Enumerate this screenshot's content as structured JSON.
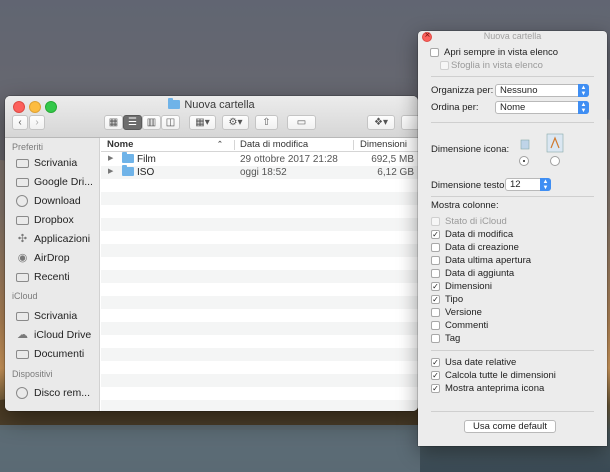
{
  "finder": {
    "title": "Nuova cartella",
    "sidebar": {
      "sections": [
        {
          "heading": "Preferiti",
          "items": [
            {
              "label": "Scrivania",
              "icon": "desktop-icon"
            },
            {
              "label": "Google Dri...",
              "icon": "folder-icon"
            },
            {
              "label": "Download",
              "icon": "download-icon"
            },
            {
              "label": "Dropbox",
              "icon": "folder-icon"
            },
            {
              "label": "Applicazioni",
              "icon": "applications-icon"
            },
            {
              "label": "AirDrop",
              "icon": "airdrop-icon"
            },
            {
              "label": "Recenti",
              "icon": "recents-icon"
            }
          ]
        },
        {
          "heading": "iCloud",
          "items": [
            {
              "label": "Scrivania",
              "icon": "desktop-icon"
            },
            {
              "label": "iCloud Drive",
              "icon": "cloud-icon"
            },
            {
              "label": "Documenti",
              "icon": "documents-icon"
            }
          ]
        },
        {
          "heading": "Dispositivi",
          "items": [
            {
              "label": "Disco rem...",
              "icon": "disk-icon"
            }
          ]
        }
      ]
    },
    "columns": {
      "name": "Nome",
      "date": "Data di modifica",
      "size": "Dimensioni"
    },
    "files": [
      {
        "name": "Film",
        "date": "29 ottobre 2017 21:28",
        "size": "692,5 MB"
      },
      {
        "name": "ISO",
        "date": "oggi 18:52",
        "size": "6,12 GB"
      }
    ]
  },
  "panel": {
    "title": "Nuova cartella",
    "open_list_view": "Apri sempre in vista elenco",
    "browse_list_view": "Sfoglia in vista elenco",
    "group_by_label": "Organizza per:",
    "group_by_value": "Nessuno",
    "sort_by_label": "Ordina per:",
    "sort_by_value": "Nome",
    "icon_size_label": "Dimensione icona:",
    "text_size_label": "Dimensione testo:",
    "text_size_value": "12",
    "show_columns_label": "Mostra colonne:",
    "columns": [
      {
        "label": "Stato di iCloud",
        "checked": false,
        "disabled": true
      },
      {
        "label": "Data di modifica",
        "checked": true,
        "disabled": false
      },
      {
        "label": "Data di creazione",
        "checked": false,
        "disabled": false
      },
      {
        "label": "Data ultima apertura",
        "checked": false,
        "disabled": false
      },
      {
        "label": "Data di aggiunta",
        "checked": false,
        "disabled": false
      },
      {
        "label": "Dimensioni",
        "checked": true,
        "disabled": false
      },
      {
        "label": "Tipo",
        "checked": true,
        "disabled": false
      },
      {
        "label": "Versione",
        "checked": false,
        "disabled": false
      },
      {
        "label": "Commenti",
        "checked": false,
        "disabled": false
      },
      {
        "label": "Tag",
        "checked": false,
        "disabled": false
      }
    ],
    "options": [
      {
        "label": "Usa date relative",
        "checked": true
      },
      {
        "label": "Calcola tutte le dimensioni",
        "checked": true
      },
      {
        "label": "Mostra anteprima icona",
        "checked": true
      }
    ],
    "default_button": "Usa come default"
  }
}
